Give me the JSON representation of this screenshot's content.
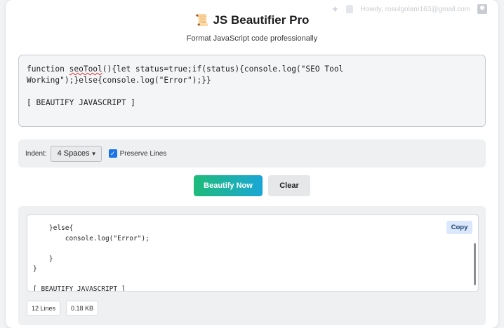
{
  "topbar": {
    "user_text": "Howdy, rosulgolam163@gmail.com"
  },
  "header": {
    "title_icon": "📜",
    "title": "JS Beautifier Pro",
    "subtitle": "Format JavaScript code professionally"
  },
  "input": {
    "code_prefix": "function ",
    "code_squiggle": "seoTool",
    "code_rest": "(){let status=true;if(status){console.log(\"SEO Tool Working\");}else{console.log(\"Error\");}}\n\n[ BEAUTIFY JAVASCRIPT ]"
  },
  "options": {
    "indent_label": "Indent:",
    "indent_value": "4 Spaces",
    "preserve_label": "Preserve Lines",
    "preserve_checked": true
  },
  "actions": {
    "beautify_label": "Beautify Now",
    "clear_label": "Clear"
  },
  "output": {
    "code": "    }else{\n        console.log(\"Error\");\n\n    }\n}\n\n[ BEAUTIFY JAVASCRIPT ]",
    "copy_label": "Copy",
    "lines_stat": "12 Lines",
    "size_stat": "0.18 KB"
  },
  "colors": {
    "primary_gradient_start": "#1fbb7a",
    "primary_gradient_end": "#1aa6d6",
    "checkbox": "#1a73e8"
  }
}
